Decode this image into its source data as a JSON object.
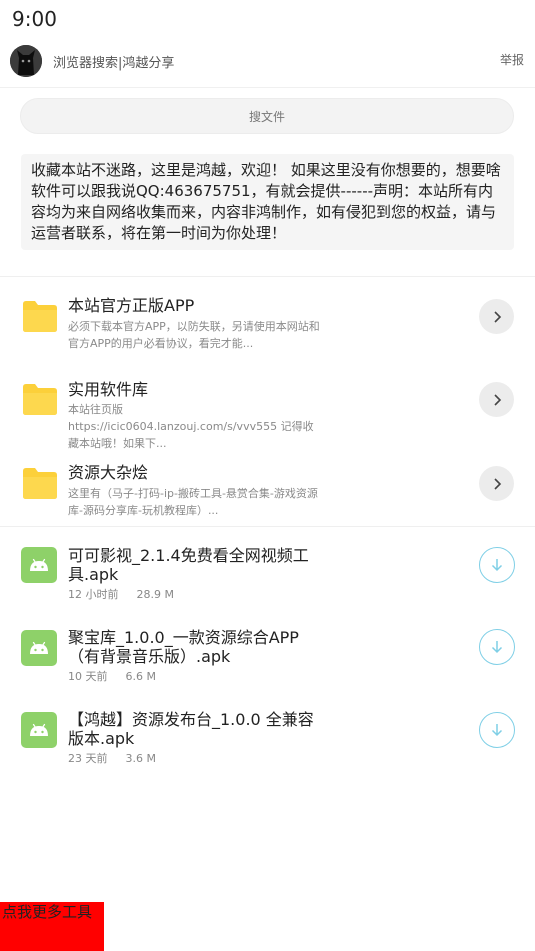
{
  "status_bar": {
    "time": "9:00"
  },
  "header": {
    "title": "浏览器搜索|鸿越分享",
    "report_label": "举报"
  },
  "search": {
    "placeholder": "搜文件"
  },
  "notice": {
    "text": "收藏本站不迷路，这里是鸿越，欢迎！ 如果这里没有你想要的，想要啥软件可以跟我说QQ:463675751，有就会提供------声明：本站所有内容均为来自网络收集而来，内容非鸿制作，如有侵犯到您的权益，请与运营者联系，将在第一时间为你处理！"
  },
  "folders": [
    {
      "title": "本站官方正版APP",
      "desc": "必须下载本官方APP，以防失联，另请使用本网站和官方APP的用户必看协议，看完才能..."
    },
    {
      "title": "实用软件库",
      "desc": "本站往页版\nhttps://icic0604.lanzouj.com/s/vvv555 记得收藏本站哦！如果下..."
    },
    {
      "title": "资源大杂烩",
      "desc": "这里有（马子-打码-ip-搬砖工具-悬赏合集-游戏资源库-源码分享库-玩机教程库）..."
    }
  ],
  "files": [
    {
      "name": "可可影视_2.1.4免费看全网视频工具.apk",
      "time": "12 小时前",
      "size": "28.9 M"
    },
    {
      "name": "聚宝库_1.0.0_一款资源综合APP（有背景音乐版）.apk",
      "time": "10 天前",
      "size": "6.6 M"
    },
    {
      "name": "【鸿越】资源发布台_1.0.0 全兼容版本.apk",
      "time": "23 天前",
      "size": "3.6 M"
    }
  ],
  "more_tools": {
    "label": "点我更多工具"
  },
  "colors": {
    "folder": "#fcd03a",
    "apk": "#8ed169",
    "download_ring": "#7fcfe6",
    "more_tools_bg": "#ff0000"
  }
}
